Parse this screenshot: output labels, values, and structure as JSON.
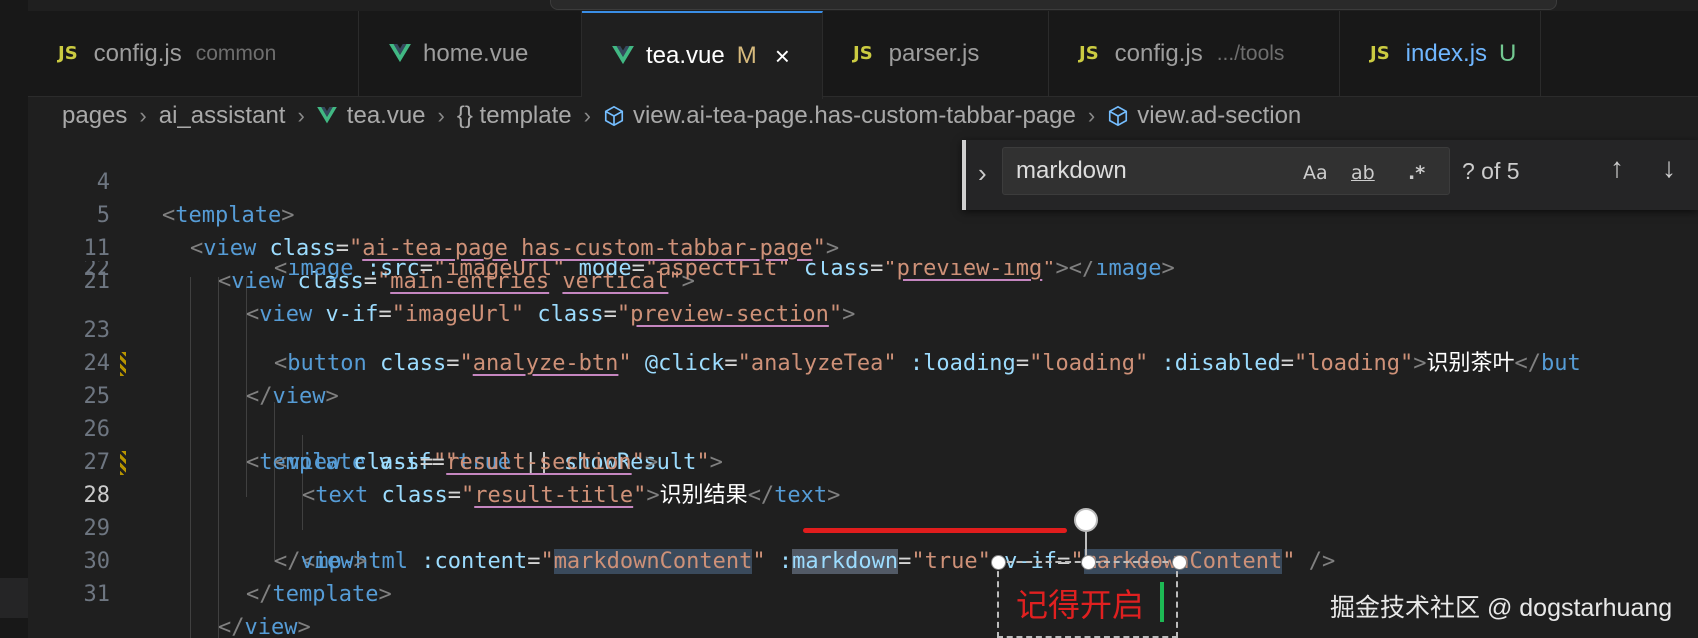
{
  "tabs": [
    {
      "name": "config.js",
      "desc": "common",
      "icon": "js-icon"
    },
    {
      "name": "home.vue",
      "icon": "vue-icon"
    },
    {
      "name": "tea.vue",
      "status": "M",
      "icon": "vue-icon",
      "active": true
    },
    {
      "name": "parser.js",
      "icon": "js-icon"
    },
    {
      "name": "config.js",
      "desc": ".../tools",
      "icon": "js-icon"
    },
    {
      "name": "index.js",
      "status": "U",
      "icon": "js-icon"
    }
  ],
  "js_badge": "JS",
  "tab_close": "×",
  "breadcrumb": [
    "pages",
    "ai_assistant",
    "tea.vue",
    "{} template",
    "view.ai-tea-page.has-custom-tabbar-page",
    "view.ad-section"
  ],
  "breadcrumb_sep": "›",
  "find": {
    "query": "markdown",
    "match_case": "Aa",
    "whole_word": "ab",
    "regex": ".*",
    "count": "? of 5",
    "prev": "↑",
    "next": "↓",
    "toggle": "›"
  },
  "line_numbers": [
    "4",
    "5",
    "11",
    "21",
    "22",
    "23",
    "24",
    "25",
    "26",
    "27",
    "28",
    "29",
    "30",
    "31"
  ],
  "code": {
    "l4": [
      "<",
      "template",
      ">"
    ],
    "l5": [
      "<",
      "view",
      " class",
      "=",
      "\"",
      "ai-tea-page",
      " ",
      "has-custom-tabbar-page",
      "\"",
      ">"
    ],
    "l11": [
      "<",
      "view",
      " class",
      "=",
      "\"",
      "main-entries",
      " ",
      "vertical",
      "\"",
      ">"
    ],
    "l21": [
      "<",
      "view",
      " v-if",
      "=",
      "\"imageUrl\"",
      " class",
      "=",
      "\"",
      "preview-section",
      "\"",
      ">"
    ],
    "l22": [
      "<",
      "image",
      " :src",
      "=",
      "\"imageUrl\"",
      " mode",
      "=",
      "\"aspectFit\"",
      " class",
      "=",
      "\"",
      "preview-img",
      "\"",
      "></",
      "image",
      ">"
    ],
    "l23": [
      "<",
      "button",
      " class",
      "=",
      "\"",
      "analyze-btn",
      "\"",
      " @click",
      "=",
      "\"analyzeTea\"",
      " :loading",
      "=",
      "\"loading\"",
      " :disabled",
      "=",
      "\"loading\"",
      ">",
      "识别茶叶",
      "</",
      "but"
    ],
    "l24": [
      "</",
      "view",
      ">"
    ],
    "l25": [
      "<",
      "template",
      " v-if",
      "=",
      "\"",
      "true",
      " || ",
      "showResult",
      "\"",
      ">"
    ],
    "l26": [
      "<",
      "view",
      " class",
      "=",
      "\"",
      "result-section",
      "\"",
      ">"
    ],
    "l27": [
      "<",
      "text",
      " class",
      "=",
      "\"",
      "result-title",
      "\"",
      ">",
      "识别结果",
      "</",
      "text",
      ">"
    ],
    "l28": [
      "<",
      "mp-html",
      " :content",
      "=",
      "\"",
      "markdownContent",
      "\"",
      " :",
      "markdown",
      "=",
      "\"true\"",
      " v-if",
      "=",
      "\"",
      "markdownContent",
      "\"",
      " />"
    ],
    "l29": [
      "</",
      "view",
      ">"
    ],
    "l30": [
      "</",
      "template",
      ">"
    ],
    "l31": [
      "</",
      "view",
      ">"
    ]
  },
  "annotation_text": "记得开启",
  "watermark": "掘金技术社区 @ dogstarhuang",
  "colors": {
    "editor_bg": "#1f1f1f",
    "tag": "#569cd6",
    "attr": "#9cdcfe",
    "string": "#ce9178",
    "punct": "#808080",
    "annotation_red": "#e02020",
    "modified": "#d7ba7d",
    "untracked": "#73c991"
  }
}
